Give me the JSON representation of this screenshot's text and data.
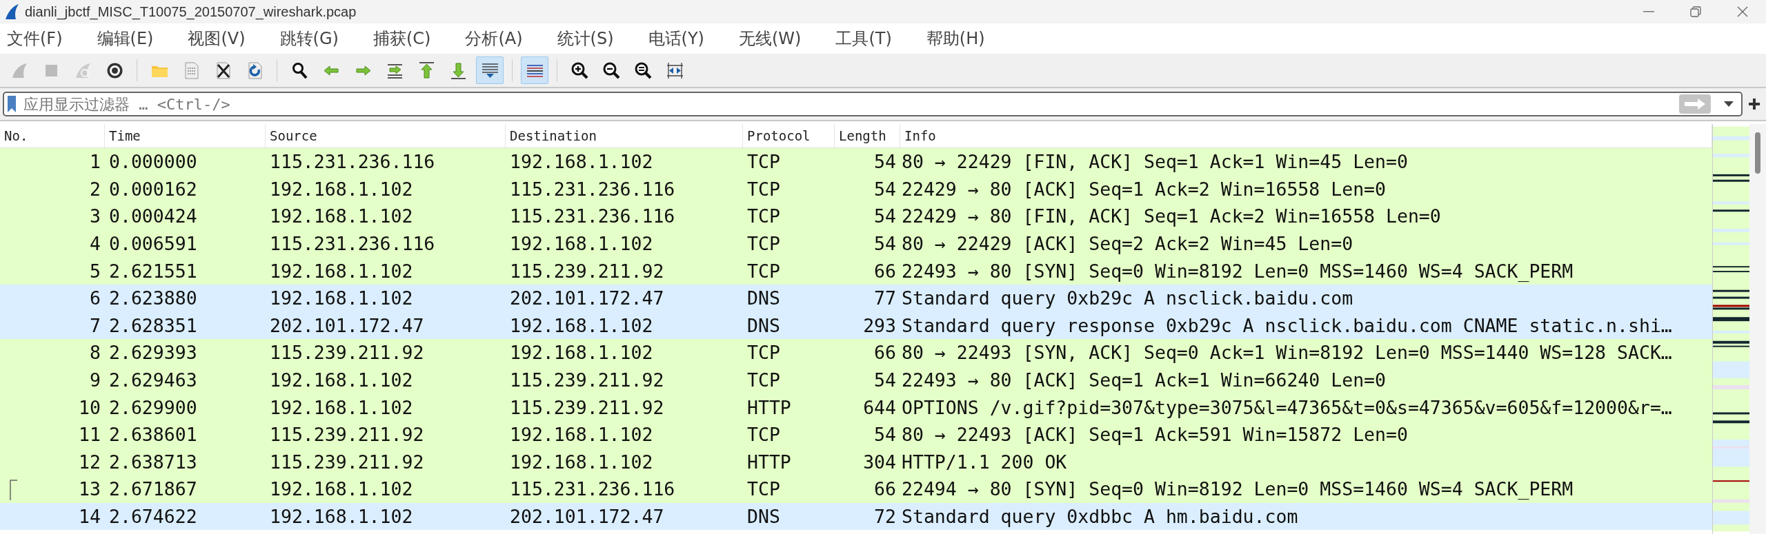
{
  "window": {
    "title": "dianli_jbctf_MISC_T10075_20150707_wireshark.pcap"
  },
  "menu": [
    "文件(F)",
    "编辑(E)",
    "视图(V)",
    "跳转(G)",
    "捕获(C)",
    "分析(A)",
    "统计(S)",
    "电话(Y)",
    "无线(W)",
    "工具(T)",
    "帮助(H)"
  ],
  "toolbar": [
    {
      "kind": "start",
      "selected": false,
      "disabled": true
    },
    {
      "kind": "stop",
      "selected": false,
      "disabled": true
    },
    {
      "kind": "restart",
      "selected": false,
      "disabled": true
    },
    {
      "kind": "options",
      "selected": false,
      "disabled": false
    },
    {
      "kind": "separator"
    },
    {
      "kind": "open",
      "selected": false,
      "disabled": false
    },
    {
      "kind": "file",
      "selected": false,
      "disabled": false
    },
    {
      "kind": "close",
      "selected": false,
      "disabled": false
    },
    {
      "kind": "reload",
      "selected": false,
      "disabled": false
    },
    {
      "kind": "separator"
    },
    {
      "kind": "find",
      "selected": false,
      "disabled": false
    },
    {
      "kind": "back",
      "selected": false,
      "disabled": false
    },
    {
      "kind": "forward",
      "selected": false,
      "disabled": false
    },
    {
      "kind": "goto",
      "selected": false,
      "disabled": false
    },
    {
      "kind": "first",
      "selected": false,
      "disabled": false
    },
    {
      "kind": "last",
      "selected": false,
      "disabled": false
    },
    {
      "kind": "autoscroll",
      "selected": true,
      "disabled": false
    },
    {
      "kind": "separator"
    },
    {
      "kind": "colorize",
      "selected": true,
      "disabled": false
    },
    {
      "kind": "separator"
    },
    {
      "kind": "zoom_in",
      "selected": false,
      "disabled": false
    },
    {
      "kind": "zoom_out",
      "selected": false,
      "disabled": false
    },
    {
      "kind": "zoom_normal",
      "selected": false,
      "disabled": false
    },
    {
      "kind": "resize",
      "selected": false,
      "disabled": false
    }
  ],
  "filter": {
    "placeholder": "应用显示过滤器 … <Ctrl-/>"
  },
  "table": {
    "columns": [
      "No.",
      "Time",
      "Source",
      "Destination",
      "Protocol",
      "Length",
      "Info"
    ],
    "rows": [
      {
        "cells": [
          "1",
          "0.000000",
          "115.231.236.116",
          "192.168.1.102",
          "TCP",
          "54",
          "80 → 22429 [FIN, ACK] Seq=1 Ack=1 Win=45 Len=0"
        ],
        "color": "#e4ffc7",
        "conversation_mark": false
      },
      {
        "cells": [
          "2",
          "0.000162",
          "192.168.1.102",
          "115.231.236.116",
          "TCP",
          "54",
          "22429 → 80 [ACK] Seq=1 Ack=2 Win=16558 Len=0"
        ],
        "color": "#e4ffc7",
        "conversation_mark": false
      },
      {
        "cells": [
          "3",
          "0.000424",
          "192.168.1.102",
          "115.231.236.116",
          "TCP",
          "54",
          "22429 → 80 [FIN, ACK] Seq=1 Ack=2 Win=16558 Len=0"
        ],
        "color": "#e4ffc7",
        "conversation_mark": false
      },
      {
        "cells": [
          "4",
          "0.006591",
          "115.231.236.116",
          "192.168.1.102",
          "TCP",
          "54",
          "80 → 22429 [ACK] Seq=2 Ack=2 Win=45 Len=0"
        ],
        "color": "#e4ffc7",
        "conversation_mark": false
      },
      {
        "cells": [
          "5",
          "2.621551",
          "192.168.1.102",
          "115.239.211.92",
          "TCP",
          "66",
          "22493 → 80 [SYN] Seq=0 Win=8192 Len=0 MSS=1460 WS=4 SACK_PERM"
        ],
        "color": "#e4ffc7",
        "conversation_mark": false
      },
      {
        "cells": [
          "6",
          "2.623880",
          "192.168.1.102",
          "202.101.172.47",
          "DNS",
          "77",
          "Standard query 0xb29c A nsclick.baidu.com"
        ],
        "color": "#daeeff",
        "conversation_mark": false
      },
      {
        "cells": [
          "7",
          "2.628351",
          "202.101.172.47",
          "192.168.1.102",
          "DNS",
          "293",
          "Standard query response 0xb29c A nsclick.baidu.com CNAME static.n.shi…"
        ],
        "color": "#daeeff",
        "conversation_mark": false
      },
      {
        "cells": [
          "8",
          "2.629393",
          "115.239.211.92",
          "192.168.1.102",
          "TCP",
          "66",
          "80 → 22493 [SYN, ACK] Seq=0 Ack=1 Win=8192 Len=0 MSS=1440 WS=128 SACK…"
        ],
        "color": "#e4ffc7",
        "conversation_mark": false
      },
      {
        "cells": [
          "9",
          "2.629463",
          "192.168.1.102",
          "115.239.211.92",
          "TCP",
          "54",
          "22493 → 80 [ACK] Seq=1 Ack=1 Win=66240 Len=0"
        ],
        "color": "#e4ffc7",
        "conversation_mark": false
      },
      {
        "cells": [
          "10",
          "2.629900",
          "192.168.1.102",
          "115.239.211.92",
          "HTTP",
          "644",
          "OPTIONS /v.gif?pid=307&type=3075&l=47365&t=0&s=47365&v=605&f=12000&r=…"
        ],
        "color": "#e4ffc7",
        "conversation_mark": false
      },
      {
        "cells": [
          "11",
          "2.638601",
          "115.239.211.92",
          "192.168.1.102",
          "TCP",
          "54",
          "80 → 22493 [ACK] Seq=1 Ack=591 Win=15872 Len=0"
        ],
        "color": "#e4ffc7",
        "conversation_mark": false
      },
      {
        "cells": [
          "12",
          "2.638713",
          "115.239.211.92",
          "192.168.1.102",
          "HTTP",
          "304",
          "HTTP/1.1 200 OK"
        ],
        "color": "#e4ffc7",
        "conversation_mark": false
      },
      {
        "cells": [
          "13",
          "2.671867",
          "192.168.1.102",
          "115.231.236.116",
          "TCP",
          "66",
          "22494 → 80 [SYN] Seq=0 Win=8192 Len=0 MSS=1460 WS=4 SACK_PERM"
        ],
        "color": "#e4ffc7",
        "conversation_mark": true
      },
      {
        "cells": [
          "14",
          "2.674622",
          "192.168.1.102",
          "202.101.172.47",
          "DNS",
          "72",
          "Standard query 0xdbbc A hm.baidu.com"
        ],
        "color": "#daeeff",
        "conversation_mark": false
      }
    ]
  }
}
